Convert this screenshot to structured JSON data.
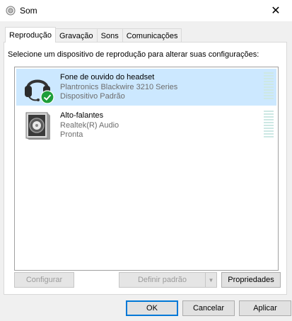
{
  "window": {
    "title": "Som",
    "close_glyph": "✕"
  },
  "tabs": [
    {
      "label": "Reprodução",
      "active": true
    },
    {
      "label": "Gravação"
    },
    {
      "label": "Sons"
    },
    {
      "label": "Comunicações"
    }
  ],
  "instruction": "Selecione um dispositivo de reprodução para alterar suas configurações:",
  "devices": [
    {
      "name": "Fone de ouvido do headset",
      "line2": "Plantronics Blackwire 3210 Series",
      "line3": "Dispositivo Padrão",
      "icon": "headset-icon",
      "selected": true,
      "default": true
    },
    {
      "name": "Alto-falantes",
      "line2": "Realtek(R) Audio",
      "line3": "Pronta",
      "icon": "speaker-icon"
    }
  ],
  "panel_buttons": {
    "configure": "Configurar",
    "set_default": "Definir padrão",
    "properties": "Propriedades"
  },
  "dialog_buttons": {
    "ok": "OK",
    "cancel": "Cancelar",
    "apply": "Aplicar"
  },
  "colors": {
    "selection": "#cce8ff",
    "default_check": "#1e9e3a",
    "focus_border": "#0078d7"
  }
}
